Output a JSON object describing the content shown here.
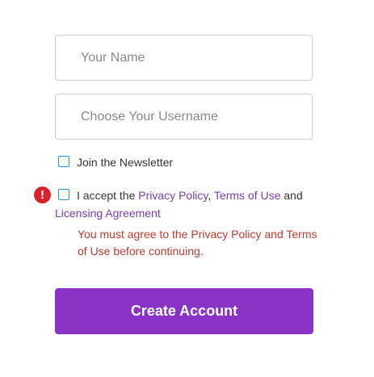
{
  "form": {
    "name_placeholder": "Your Name",
    "username_placeholder": "Choose Your Username",
    "newsletter_label": "Join the Newsletter",
    "terms": {
      "prefix": "I accept the ",
      "privacy_link": "Privacy Policy",
      "comma": ", ",
      "terms_link": "Terms of Use",
      "and": " and",
      "licensing_link": "Licensing Agreement"
    },
    "error_icon_glyph": "!",
    "error_message": "You must agree to the Privacy Policy and Terms of Use before continuing.",
    "submit_label": "Create Account"
  },
  "colors": {
    "accent": "#8a34c6",
    "link": "#7a3bb0",
    "error": "#c0392b",
    "error_icon": "#d8232a",
    "checkbox_border": "#2f8fd6"
  },
  "icons": {
    "error": "exclamation-circle-icon"
  }
}
